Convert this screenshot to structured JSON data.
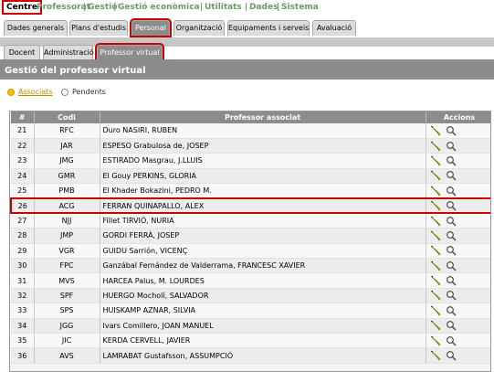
{
  "top_menu": {
    "items": [
      "Centre",
      "Professorat",
      "Gestió",
      "Gestió econòmica",
      "Utilitats",
      "Dades",
      "Sistema"
    ],
    "separator": "|"
  },
  "tabs_primary": [
    "Dades generals",
    "Plans d'estudis",
    "Personal",
    "Organització",
    "Equipaments i serveis",
    "Avaluació"
  ],
  "tabs_secondary": [
    "Docent",
    "Administració",
    "Professor virtual"
  ],
  "section_title": "Gestió del professor virtual",
  "radios": {
    "associats": "Associats",
    "pendents": "Pendents",
    "selected": "associats"
  },
  "table": {
    "headers": [
      "#",
      "Codi",
      "Professor associat",
      "Accions"
    ],
    "rows": [
      {
        "num": "21",
        "code": "RFC",
        "name": "Duro NASIRI, RUBEN"
      },
      {
        "num": "22",
        "code": "JAR",
        "name": "ESPESO Grabulosa de, JOSEP"
      },
      {
        "num": "23",
        "code": "JMG",
        "name": "ESTIRADO Masgrau, J.LLUIS"
      },
      {
        "num": "24",
        "code": "GMR",
        "name": "El Gouy PERKINS, GLORIA"
      },
      {
        "num": "25",
        "code": "PMB",
        "name": "El Khader Bokazini, PEDRO M."
      },
      {
        "num": "26",
        "code": "ACG",
        "name": "FERRAN QUINAPALLO, ALEX",
        "highlighted": true
      },
      {
        "num": "27",
        "code": "NJJ",
        "name": "Fillet TIRVIÓ, NURIA"
      },
      {
        "num": "28",
        "code": "JMP",
        "name": "GORDI FERRÀ, JOSEP"
      },
      {
        "num": "29",
        "code": "VGR",
        "name": "GUIDU Sarrión, VICENÇ"
      },
      {
        "num": "30",
        "code": "FPC",
        "name": "Ganzábal Fernández de Valderrama, FRANCESC XAVIER"
      },
      {
        "num": "31",
        "code": "MVS",
        "name": "HARCEA Palus, M. LOURDES"
      },
      {
        "num": "32",
        "code": "SPF",
        "name": "HUERGO Mocholí, SALVADOR"
      },
      {
        "num": "33",
        "code": "SPS",
        "name": "HUISKAMP AZNAR, SILVIA"
      },
      {
        "num": "34",
        "code": "JGG",
        "name": "Ivars Comillero, JOAN MANUEL"
      },
      {
        "num": "35",
        "code": "JIC",
        "name": "KERDA CERVELL, JAVIER"
      },
      {
        "num": "36",
        "code": "AVS",
        "name": "LAMRABAT Gustafsson, ASSUMPCIÓ"
      }
    ]
  },
  "colors": {
    "header_gray": "#8c8c8c",
    "highlight_red": "#cc0000",
    "menu_green": "#6a9a6a",
    "radio_yellow": "#f2c200"
  },
  "icons": [
    "edit-pencil-icon",
    "search-magnifier-icon"
  ]
}
